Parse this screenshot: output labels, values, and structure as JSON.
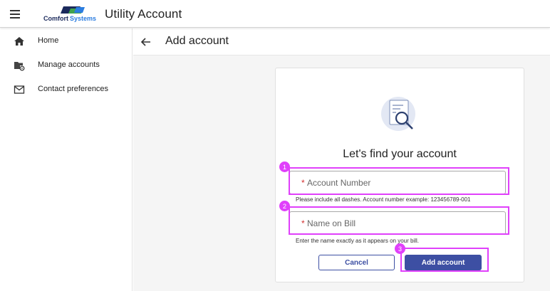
{
  "app": {
    "title": "Utility Account",
    "logo": {
      "word_a": "Comfort",
      "word_b": "Systems",
      "color_a": "#1b2a5c",
      "color_b": "#2b7de0"
    }
  },
  "icons": {
    "menu": "hamburger-icon",
    "home": "home-icon",
    "manage": "folder-gear-icon",
    "contact": "mail-icon",
    "back": "arrow-left-icon",
    "illustration": "document-magnifier-icon"
  },
  "sidebar": {
    "items": [
      {
        "label": "Home"
      },
      {
        "label": "Manage accounts"
      },
      {
        "label": "Contact preferences"
      }
    ]
  },
  "page": {
    "title": "Add account"
  },
  "form": {
    "heading": "Let's find your account",
    "required_mark": "*",
    "account_number": {
      "value": "",
      "placeholder": "Account Number",
      "hint": "Please include all dashes. Account number example: 123456789-001"
    },
    "name_on_bill": {
      "value": "",
      "placeholder": "Name on Bill",
      "hint": "Enter the name exactly as it appears on your bill."
    },
    "cancel_label": "Cancel",
    "submit_label": "Add account"
  },
  "annotations": {
    "badge_1": "1",
    "badge_2": "2",
    "badge_3": "3"
  },
  "colors": {
    "primary": "#3d4fa3",
    "annotation": "#e040fb",
    "required": "#d32f2f",
    "background": "#f5f5f5"
  }
}
